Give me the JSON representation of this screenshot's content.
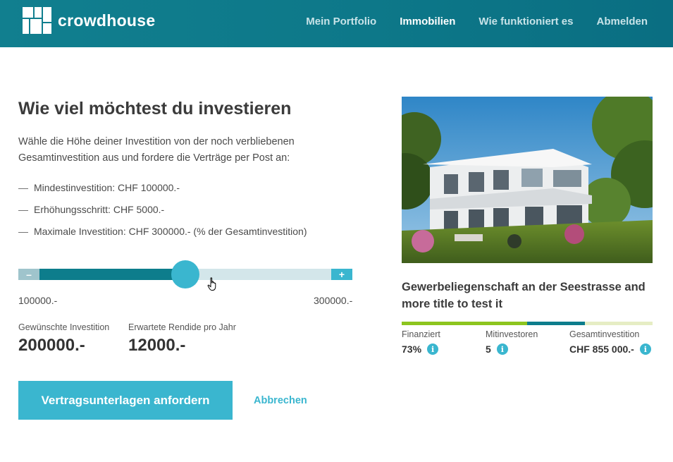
{
  "header": {
    "brand": "crowdhouse",
    "nav": [
      {
        "label": "Mein Portfolio",
        "active": false
      },
      {
        "label": "Immobilien",
        "active": true
      },
      {
        "label": "Wie funktioniert es",
        "active": false
      },
      {
        "label": "Abmelden",
        "active": false
      }
    ]
  },
  "invest": {
    "title": "Wie viel möchtest du investieren",
    "intro": "Wähle die Höhe deiner Investition von der noch verbliebenen Gesamtinvestition aus und fordere die Verträge per Post an:",
    "facts": [
      "Mindestinvestition: CHF 100000.-",
      "Erhöhungsschritt: CHF 5000.-",
      "Maximale Investition: CHF 300000.- (% der Gesamtinvestition)"
    ],
    "slider": {
      "minus_label": "–",
      "plus_label": "+",
      "min": 100000,
      "max": 300000,
      "value": 200000,
      "min_label": "100000.-",
      "max_label": "300000.-"
    },
    "desired_label": "Gewünschte Investition",
    "desired_value": "200000.-",
    "return_label": "Erwartete Rendide pro Jahr",
    "return_value": "12000.-",
    "cta_label": "Vertragsunterlagen anfordern",
    "cancel_label": "Abbrechen"
  },
  "property": {
    "title": "Gewerbeliegenschaft an der Seestrasse and more title to test it",
    "financed_fraction": 0.73,
    "investors_fraction_end": 0.73,
    "kpis": [
      {
        "label": "Finanziert",
        "value": "73%"
      },
      {
        "label": "Mitinvestoren",
        "value": "5"
      },
      {
        "label": "Gesamtinvestition",
        "value": "CHF 855 000.-"
      }
    ],
    "info_glyph": "i"
  },
  "colors": {
    "header": "#0d7889",
    "accent": "#3ab6cf",
    "fill": "#0d7d8c",
    "progress_green": "#8dc51f"
  }
}
